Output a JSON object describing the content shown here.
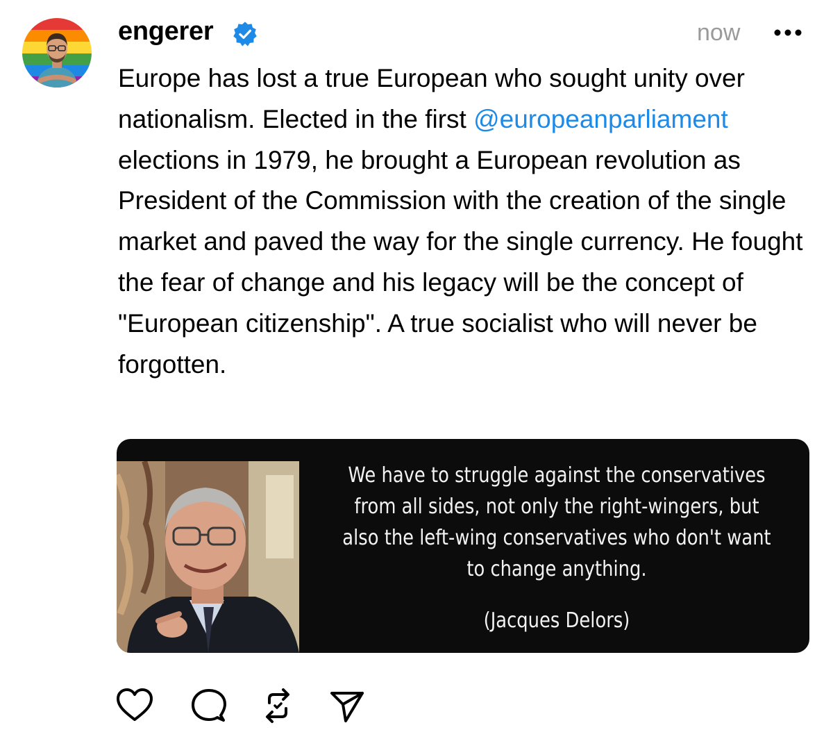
{
  "post": {
    "username": "engerer",
    "verified": true,
    "timestamp": "now",
    "more_icon": "more-horizontal-icon",
    "text_before_mention": "Europe has lost a true European who sought unity over nationalism. Elected in the first ",
    "mention": "@europeanparliament",
    "text_after_mention": " elections in 1979, he brought a European revolution as President of the Commission with the creation of the single market and paved the way for the single currency. He fought the fear of change and his legacy will be the concept of \"European citizenship\". A true socialist who will never be forgotten."
  },
  "quote_image": {
    "quote": "We have to struggle against the conservatives from all sides, not only the right-wingers, but also the left-wing conservatives who don't want to change anything.",
    "author": "(Jacques Delors)"
  },
  "actions": [
    {
      "name": "like",
      "icon": "heart-icon"
    },
    {
      "name": "reply",
      "icon": "comment-icon"
    },
    {
      "name": "repost",
      "icon": "repost-icon"
    },
    {
      "name": "share",
      "icon": "send-icon"
    }
  ],
  "colors": {
    "mention": "#1d8ae8",
    "verified_badge": "#1d8ae8",
    "timestamp": "#9a9a9a",
    "quote_card_bg": "#0c0c0c"
  }
}
